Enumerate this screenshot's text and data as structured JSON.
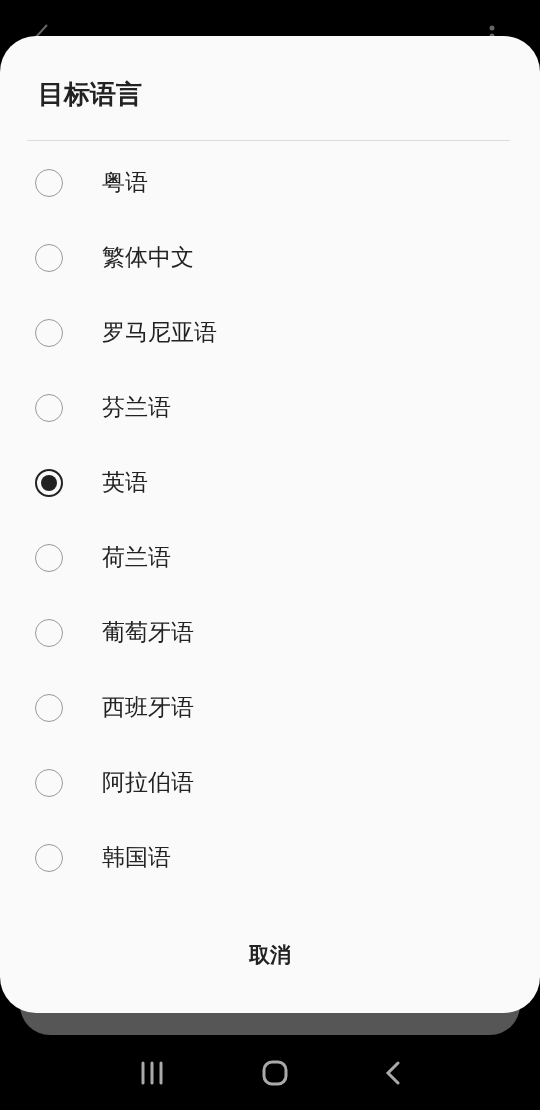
{
  "dialog": {
    "title": "目标语言",
    "options": [
      {
        "label": "粤语",
        "selected": false
      },
      {
        "label": "繁体中文",
        "selected": false
      },
      {
        "label": "罗马尼亚语",
        "selected": false
      },
      {
        "label": "芬兰语",
        "selected": false
      },
      {
        "label": "英语",
        "selected": true
      },
      {
        "label": "荷兰语",
        "selected": false
      },
      {
        "label": "葡萄牙语",
        "selected": false
      },
      {
        "label": "西班牙语",
        "selected": false
      },
      {
        "label": "阿拉伯语",
        "selected": false
      },
      {
        "label": "韩国语",
        "selected": false
      }
    ],
    "cancel_button": "取消"
  }
}
